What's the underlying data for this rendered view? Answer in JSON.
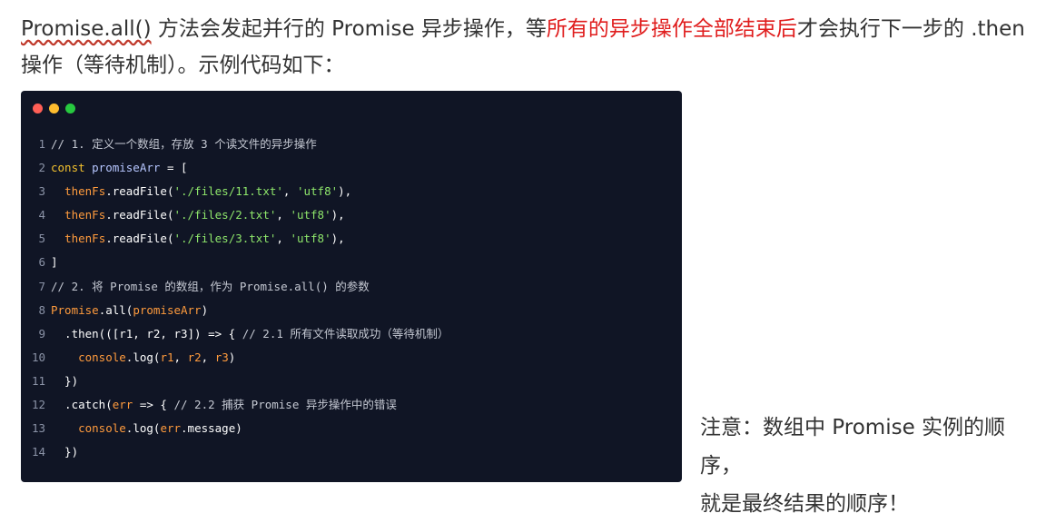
{
  "intro": {
    "line1_a": "Promise.all()",
    "line1_b": " 方法会发起并行的 Promise 异步操作，等",
    "line1_highlight": "所有的异步操作全部结束后",
    "line1_c": "才会执行下一步的 .then",
    "line2": "操作（等待机制）。示例代码如下："
  },
  "window_dots": [
    {
      "icon": "close-dot-icon",
      "color": "#ff5f56"
    },
    {
      "icon": "minimize-dot-icon",
      "color": "#ffbd2e"
    },
    {
      "icon": "maximize-dot-icon",
      "color": "#27c93f"
    }
  ],
  "code": {
    "lines": [
      {
        "n": "1",
        "t": [
          {
            "c": "c-comment",
            "s": "// 1. 定义一个数组，存放 3 个读文件的异步操作"
          }
        ]
      },
      {
        "n": "2",
        "t": [
          {
            "c": "c-kw",
            "s": "const "
          },
          {
            "c": "c-var",
            "s": "promiseArr"
          },
          {
            "c": "c-punc",
            "s": " = ["
          }
        ]
      },
      {
        "n": "3",
        "t": [
          {
            "c": "c-punc",
            "s": "  "
          },
          {
            "c": "c-fn",
            "s": "thenFs"
          },
          {
            "c": "c-punc",
            "s": ".readFile("
          },
          {
            "c": "c-str",
            "s": "'./files/11.txt'"
          },
          {
            "c": "c-punc",
            "s": ", "
          },
          {
            "c": "c-str",
            "s": "'utf8'"
          },
          {
            "c": "c-punc",
            "s": "),"
          }
        ]
      },
      {
        "n": "4",
        "t": [
          {
            "c": "c-punc",
            "s": "  "
          },
          {
            "c": "c-fn",
            "s": "thenFs"
          },
          {
            "c": "c-punc",
            "s": ".readFile("
          },
          {
            "c": "c-str",
            "s": "'./files/2.txt'"
          },
          {
            "c": "c-punc",
            "s": ", "
          },
          {
            "c": "c-str",
            "s": "'utf8'"
          },
          {
            "c": "c-punc",
            "s": "),"
          }
        ]
      },
      {
        "n": "5",
        "t": [
          {
            "c": "c-punc",
            "s": "  "
          },
          {
            "c": "c-fn",
            "s": "thenFs"
          },
          {
            "c": "c-punc",
            "s": ".readFile("
          },
          {
            "c": "c-str",
            "s": "'./files/3.txt'"
          },
          {
            "c": "c-punc",
            "s": ", "
          },
          {
            "c": "c-str",
            "s": "'utf8'"
          },
          {
            "c": "c-punc",
            "s": "),"
          }
        ]
      },
      {
        "n": "6",
        "t": [
          {
            "c": "c-punc",
            "s": "]"
          }
        ]
      },
      {
        "n": "7",
        "t": [
          {
            "c": "c-comment",
            "s": "// 2. 将 Promise 的数组，作为 Promise.all() 的参数"
          }
        ]
      },
      {
        "n": "8",
        "t": [
          {
            "c": "c-fn",
            "s": "Promise"
          },
          {
            "c": "c-punc",
            "s": ".all("
          },
          {
            "c": "c-fn",
            "s": "promiseArr"
          },
          {
            "c": "c-punc",
            "s": ")"
          }
        ]
      },
      {
        "n": "9",
        "t": [
          {
            "c": "c-punc",
            "s": "  .then(([r1, r2, r3]) => { "
          },
          {
            "c": "c-comment",
            "s": "// 2.1 所有文件读取成功（等待机制）"
          }
        ]
      },
      {
        "n": "10",
        "t": [
          {
            "c": "c-punc",
            "s": "    "
          },
          {
            "c": "c-fn",
            "s": "console"
          },
          {
            "c": "c-punc",
            "s": ".log("
          },
          {
            "c": "c-fn",
            "s": "r1"
          },
          {
            "c": "c-punc",
            "s": ", "
          },
          {
            "c": "c-fn",
            "s": "r2"
          },
          {
            "c": "c-punc",
            "s": ", "
          },
          {
            "c": "c-fn",
            "s": "r3"
          },
          {
            "c": "c-punc",
            "s": ")"
          }
        ]
      },
      {
        "n": "11",
        "t": [
          {
            "c": "c-punc",
            "s": "  })"
          }
        ]
      },
      {
        "n": "12",
        "t": [
          {
            "c": "c-punc",
            "s": "  .catch("
          },
          {
            "c": "c-fn",
            "s": "err"
          },
          {
            "c": "c-punc",
            "s": " => { "
          },
          {
            "c": "c-comment",
            "s": "// 2.2 捕获 Promise 异步操作中的错误"
          }
        ]
      },
      {
        "n": "13",
        "t": [
          {
            "c": "c-punc",
            "s": "    "
          },
          {
            "c": "c-fn",
            "s": "console"
          },
          {
            "c": "c-punc",
            "s": ".log("
          },
          {
            "c": "c-fn",
            "s": "err"
          },
          {
            "c": "c-punc",
            "s": ".message)"
          }
        ]
      },
      {
        "n": "14",
        "t": [
          {
            "c": "c-punc",
            "s": "  })"
          }
        ]
      }
    ]
  },
  "note": {
    "line1": "注意：数组中 Promise 实例的顺序，",
    "line2": "就是最终结果的顺序！"
  }
}
